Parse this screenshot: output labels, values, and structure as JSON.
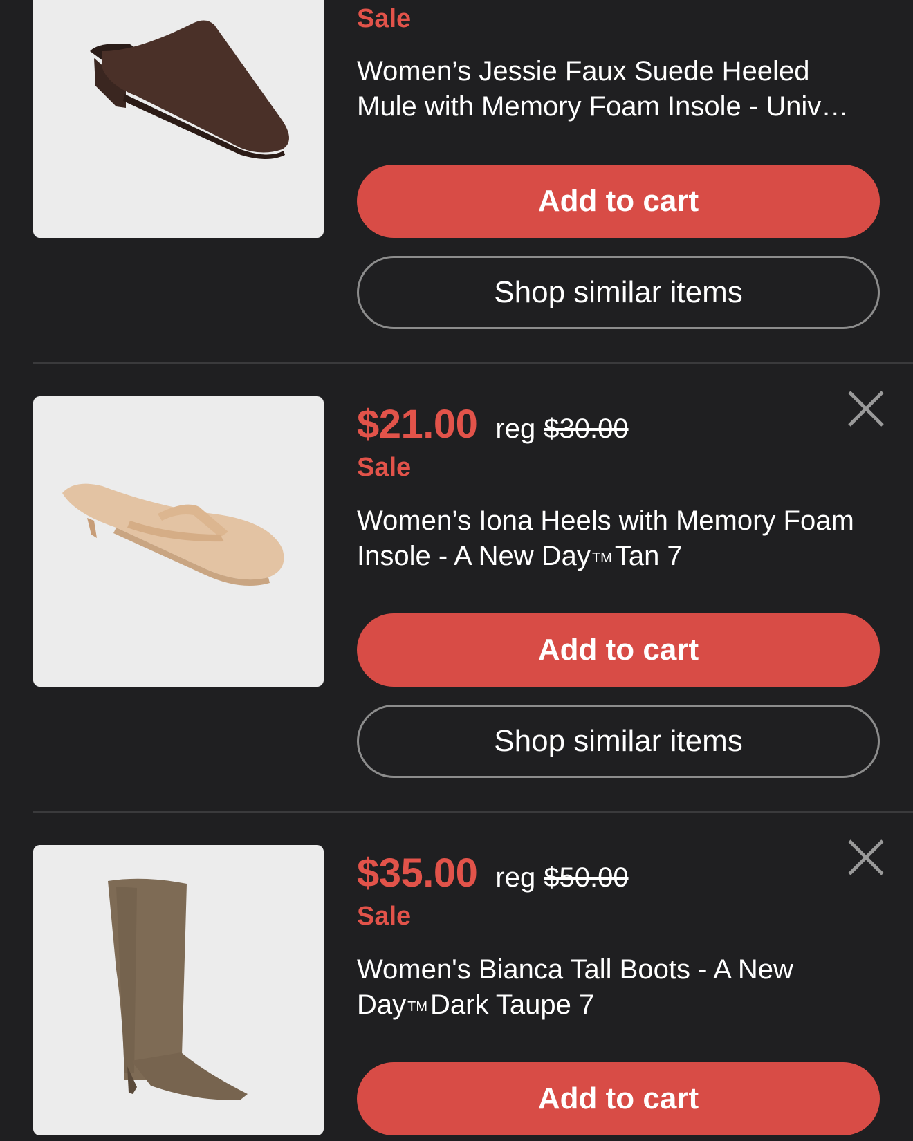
{
  "colors": {
    "background": "#1f1f21",
    "accent": "#e2534a",
    "cart_button": "#d84c46",
    "text": "#ffffff",
    "outline": "#8c8c8c"
  },
  "items": [
    {
      "sale_label": "Sale",
      "title_line1": "Women’s Jessie Faux Suede Heeled",
      "title_line2": "Mule with Memory Foam Insole - Univ…",
      "add_to_cart": "Add to cart",
      "shop_similar": "Shop similar items",
      "image_icon": "brown-mule-shoe"
    },
    {
      "price": "$21.00",
      "reg_label": "reg",
      "reg_price": "$30.00",
      "sale_label": "Sale",
      "title_line1": "Women’s Iona Heels with Memory Foam",
      "title_line2_a": "Insole - A New Day",
      "title_tm": "TM",
      "title_line2_b": "Tan 7",
      "add_to_cart": "Add to cart",
      "shop_similar": "Shop similar items",
      "image_icon": "tan-thong-heel-sandal",
      "close_icon": "close-icon"
    },
    {
      "price": "$35.00",
      "reg_label": "reg",
      "reg_price": "$50.00",
      "sale_label": "Sale",
      "title_line1": "Women's Bianca Tall Boots - A New",
      "title_line2_a": "Day",
      "title_tm": "TM",
      "title_line2_b": "Dark Taupe 7",
      "add_to_cart": "Add to cart",
      "image_icon": "taupe-tall-boot",
      "close_icon": "close-icon"
    }
  ]
}
